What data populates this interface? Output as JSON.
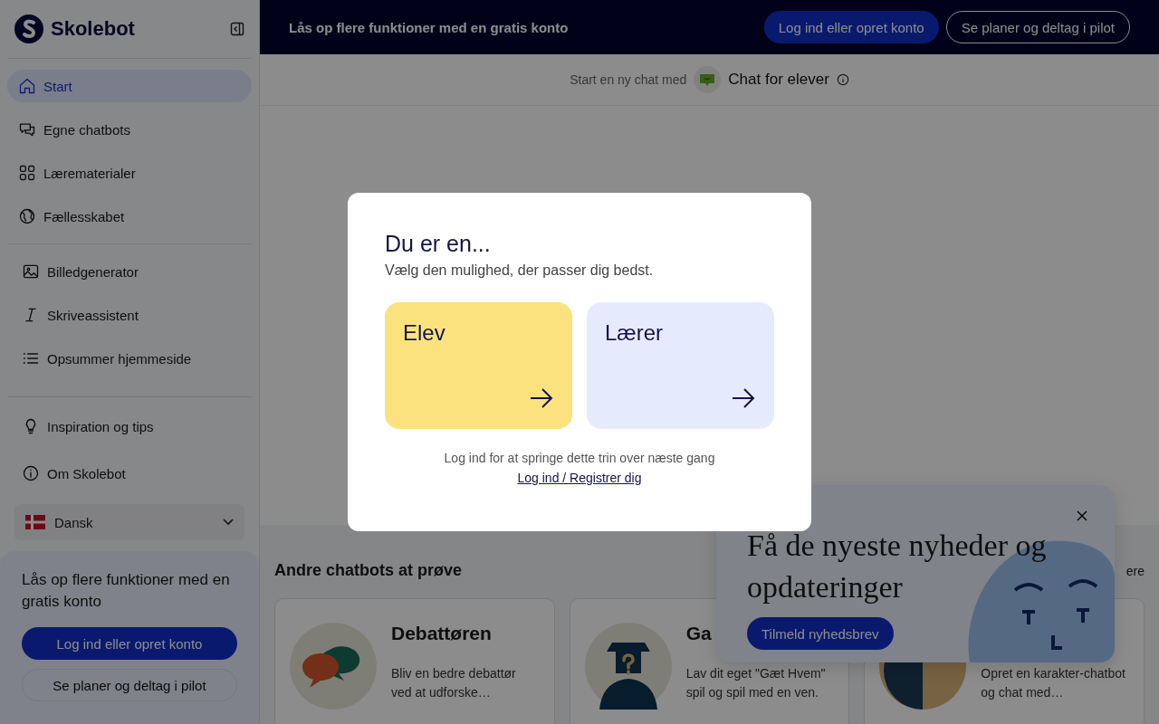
{
  "brand": {
    "name": "Skolebot"
  },
  "sidebar": {
    "groups": [
      {
        "items": [
          {
            "label": "Start",
            "selected": true
          },
          {
            "label": "Egne chatbots",
            "selected": false
          },
          {
            "label": "Lærematerialer",
            "selected": false
          },
          {
            "label": "Fællesskabet",
            "selected": false
          }
        ]
      },
      {
        "items": [
          {
            "label": "Billedgenerator",
            "selected": false
          },
          {
            "label": "Skriveassistent",
            "selected": false
          },
          {
            "label": "Opsummer hjemmeside",
            "selected": false
          }
        ]
      },
      {
        "items": [
          {
            "label": "Inspiration og tips",
            "selected": false
          },
          {
            "label": "Om Skolebot",
            "selected": false
          }
        ]
      }
    ],
    "language": {
      "label": "Dansk"
    },
    "promo": {
      "text": "Lås op flere funktioner med en gratis konto",
      "primary": "Log ind eller opret konto",
      "secondary": "Se planer og deltag i pilot"
    }
  },
  "banner": {
    "text": "Lås op flere funktioner med en gratis konto",
    "primary": "Log ind eller opret konto",
    "secondary": "Se planer og deltag i pilot"
  },
  "chat_header": {
    "prefix": "Start en ny chat med",
    "bot": "Chat for elever"
  },
  "section": {
    "title": "Andre chatbots at prøve",
    "link": "ere",
    "cards": [
      {
        "title": "Debattøren",
        "description": "Bliv en bedre debattør ved at udforske…"
      },
      {
        "title": "Ga",
        "description": "Lav dit eget \"Gæt Hvem\" spil og spil med en ven."
      },
      {
        "description": "Opret en karakter-chatbot og chat med…"
      }
    ]
  },
  "newsletter": {
    "title": "Få de nyeste nyheder og opdateringer",
    "button": "Tilmeld nyhedsbrev"
  },
  "dialog": {
    "title": "Du er en...",
    "subtitle": "Vælg den mulighed, der passer dig bedst.",
    "options": [
      {
        "label": "Elev",
        "color": "#fce27f"
      },
      {
        "label": "Lærer",
        "color": "#e5ebfc"
      }
    ],
    "note": "Log ind for at springe dette trin over næste gang",
    "link": "Log ind / Registrer dig"
  }
}
